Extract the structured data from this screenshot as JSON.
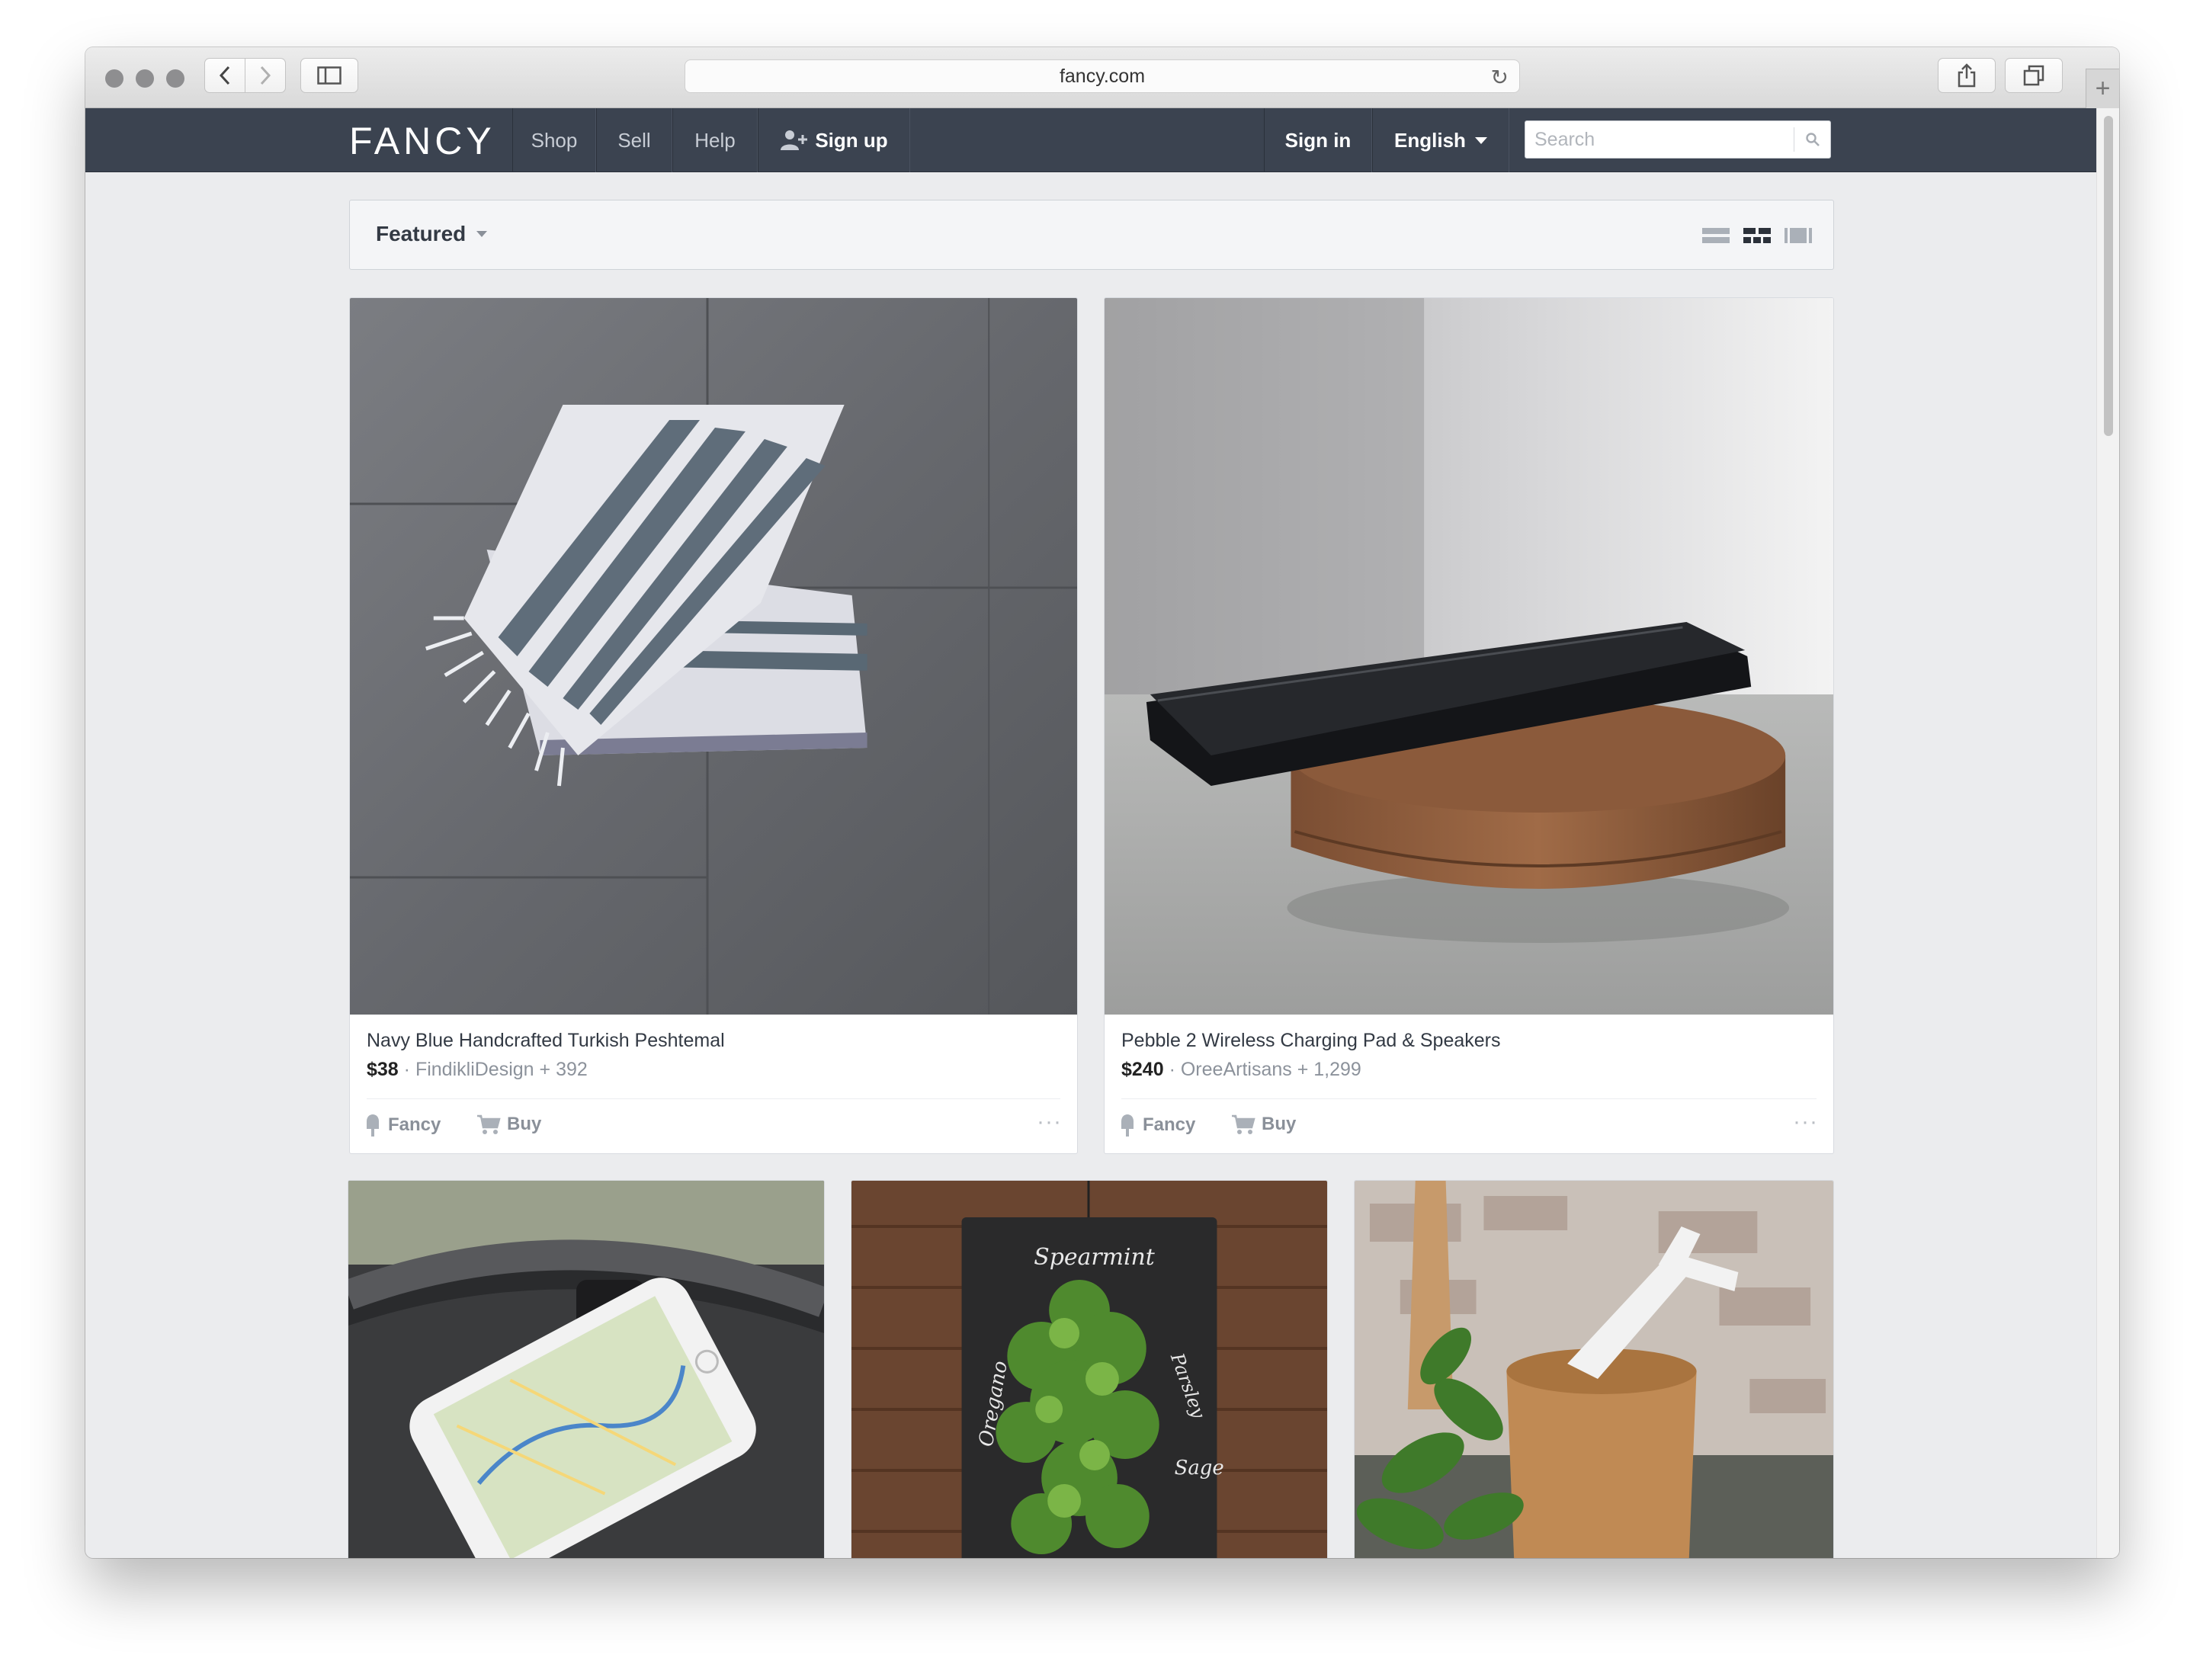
{
  "browser": {
    "url": "fancy.com"
  },
  "site": {
    "logo": "FANCY",
    "nav": {
      "shop": "Shop",
      "sell": "Sell",
      "help": "Help",
      "signup": "Sign up",
      "signin": "Sign in",
      "language": "English"
    },
    "search": {
      "placeholder": "Search"
    }
  },
  "filter": {
    "sort_label": "Featured"
  },
  "products": [
    {
      "title": "Navy Blue Handcrafted Turkish Peshtemal",
      "price": "$38",
      "seller": "FindikliDesign",
      "count": "+ 392",
      "fancy_label": "Fancy",
      "buy_label": "Buy",
      "more": "···"
    },
    {
      "title": "Pebble 2 Wireless Charging Pad & Speakers",
      "price": "$240",
      "seller": "OreeArtisans",
      "count": "+ 1,299",
      "fancy_label": "Fancy",
      "buy_label": "Buy",
      "more": "···"
    }
  ],
  "herb_sign": {
    "spearmint": "Spearmint",
    "oregano": "Oregano",
    "parsley": "Parsley",
    "sage": "Sage"
  }
}
